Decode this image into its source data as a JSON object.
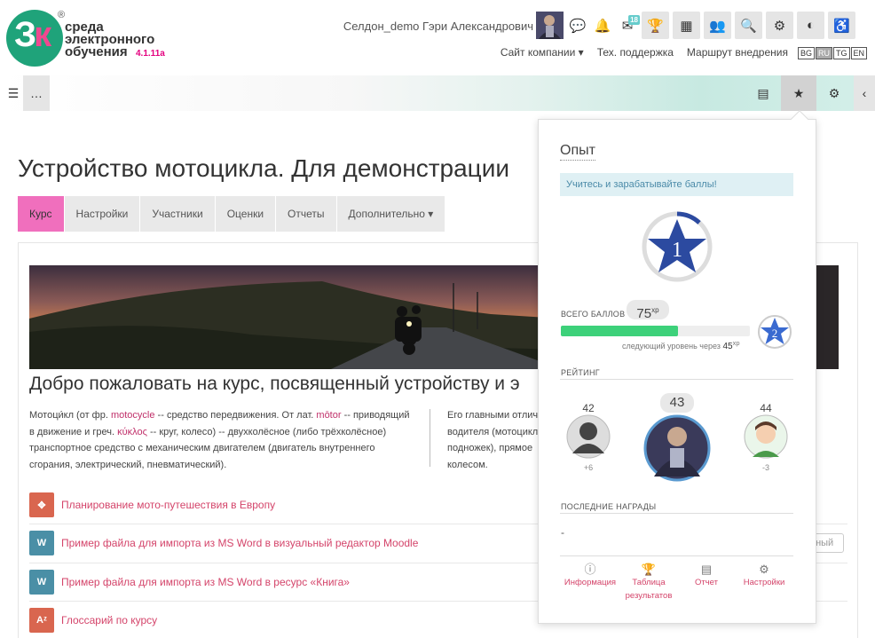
{
  "logo": {
    "line1": "среда",
    "line2": "электронного",
    "line3": "обучения",
    "version": "4.1.11a",
    "reg": "®"
  },
  "header": {
    "user_name": "Селдон_demo Гэри Александрович",
    "msg_badge": "18",
    "nav": [
      "Сайт компании",
      "Тех. поддержка",
      "Маршрут внедрения"
    ],
    "langs": [
      "BG",
      "RU",
      "TG",
      "EN"
    ],
    "active_lang": "RU"
  },
  "page": {
    "title": "Устройство мотоцикла. Для демонстрации",
    "tabs": [
      "Курс",
      "Настройки",
      "Участники",
      "Оценки",
      "Отчеты",
      "Дополнительно"
    ],
    "welcome": "Добро пожаловать на курс, посвященный устройству и э",
    "para1_a": "Мотоци́кл (от фр. ",
    "para1_b": "motocycle",
    "para1_c": " -- средство передвижения. От лат. ",
    "para1_d": "mōtor",
    "para1_e": " -- приводящий в движение и греч. ",
    "para1_f": "κύκλος",
    "para1_g": " -- круг, колесо) -- двухколёсное (либо трёхколёсное) транспортное средство с механическим двигателем (двигатель внутреннего сгорания, электрический, пневматический).",
    "para2_lines": [
      "Его главными отлич",
      "водителя (мотоцикл",
      "подножек), прямое",
      "колесом."
    ],
    "activities": [
      {
        "label": "Планирование мото-путешествия в Европу",
        "icon": "✥",
        "color": "#d9664f"
      },
      {
        "label": "Пример файла для импорта из MS Word в визуальный редактор Moodle",
        "icon": "W",
        "color": "#4a8fa6"
      },
      {
        "label": "Пример файла для импорта из MS Word в ресурс «Книга»",
        "icon": "W",
        "color": "#4a8fa6"
      },
      {
        "label": "Глоссарий по курсу",
        "icon": "Aᶻ",
        "color": "#d9664f"
      }
    ],
    "completion_text": "нный"
  },
  "xp": {
    "title": "Опыт",
    "info": "Учитесь и зарабатывайте баллы!",
    "level": "1",
    "next_level": "2",
    "progress": 0.62,
    "total_label": "ВСЕГО БАЛЛОВ",
    "total_value": "75",
    "xp_unit": "xp",
    "next_text": "следующий уровень через",
    "next_value": "45",
    "rating_label": "РЕЙТИНГ",
    "rating": [
      {
        "rank": "42",
        "delta": "+6"
      },
      {
        "rank": "43",
        "delta": ""
      },
      {
        "rank": "44",
        "delta": "-3"
      }
    ],
    "recent_label": "ПОСЛЕДНИЕ НАГРАДЫ",
    "recent_value": "-",
    "footer": [
      {
        "label": "Информация",
        "icon": "ⓘ"
      },
      {
        "label": "Таблица результатов",
        "icon": "🏆"
      },
      {
        "label": "Отчет",
        "icon": "▤"
      },
      {
        "label": "Настройки",
        "icon": "⚙"
      }
    ]
  }
}
